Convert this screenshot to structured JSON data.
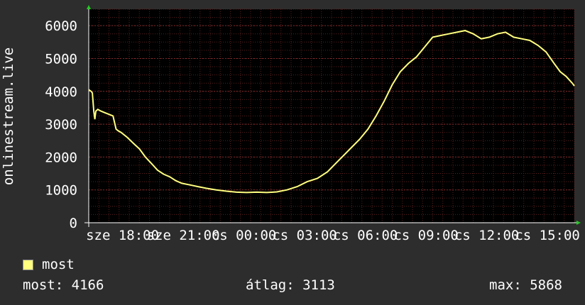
{
  "chart_data": {
    "type": "line",
    "ylabel": "onlinestream.live",
    "ylim": [
      0,
      6500
    ],
    "yticks": [
      0,
      1000,
      2000,
      3000,
      4000,
      5000,
      6000
    ],
    "xticks": [
      {
        "x": 1.67,
        "label": "sze 18:00"
      },
      {
        "x": 4.67,
        "label": "sze 21:00"
      },
      {
        "x": 7.67,
        "label": "cs 00:00"
      },
      {
        "x": 10.67,
        "label": "cs 03:00"
      },
      {
        "x": 13.67,
        "label": "cs 06:00"
      },
      {
        "x": 16.67,
        "label": "cs 09:00"
      },
      {
        "x": 19.67,
        "label": "cs 12:00"
      },
      {
        "x": 22.67,
        "label": "cs 15:00"
      }
    ],
    "xlim": [
      0,
      24
    ],
    "grid": true,
    "colors": {
      "background": "#2d2d2d",
      "plot": "#000000",
      "grid": "#5a1e1e",
      "line": "#ffff80",
      "axis": "#ffffff"
    },
    "series": [
      {
        "name": "most",
        "x": [
          0,
          0.12,
          0.18,
          0.25,
          0.3,
          0.35,
          0.45,
          0.6,
          0.8,
          1.0,
          1.2,
          1.35,
          1.45,
          1.6,
          1.9,
          2.2,
          2.5,
          2.8,
          3.1,
          3.4,
          3.7,
          4.0,
          4.3,
          4.6,
          5.0,
          5.4,
          5.8,
          6.3,
          6.8,
          7.3,
          7.8,
          8.3,
          8.8,
          9.3,
          9.8,
          10.3,
          10.8,
          11.3,
          11.8,
          12.2,
          12.6,
          13.0,
          13.4,
          13.8,
          14.2,
          14.6,
          15.0,
          15.4,
          15.8,
          16.2,
          16.6,
          17.0,
          17.4,
          17.8,
          18.2,
          18.6,
          19.0,
          19.4,
          19.8,
          20.2,
          20.6,
          21.0,
          21.4,
          21.8,
          22.2,
          22.6,
          23.0,
          23.3,
          23.6,
          23.9,
          24.0
        ],
        "values": [
          4050,
          4000,
          3950,
          3400,
          3150,
          3400,
          3450,
          3400,
          3350,
          3300,
          3250,
          2850,
          2800,
          2750,
          2600,
          2420,
          2250,
          2000,
          1800,
          1600,
          1480,
          1400,
          1280,
          1200,
          1150,
          1100,
          1050,
          1000,
          960,
          930,
          920,
          930,
          920,
          940,
          1000,
          1100,
          1250,
          1350,
          1550,
          1800,
          2050,
          2300,
          2550,
          2850,
          3250,
          3700,
          4200,
          4600,
          4850,
          5050,
          5350,
          5650,
          5700,
          5750,
          5800,
          5850,
          5750,
          5600,
          5650,
          5750,
          5800,
          5650,
          5600,
          5550,
          5400,
          5200,
          4850,
          4600,
          4450,
          4250,
          4166
        ]
      }
    ]
  },
  "legend": {
    "series_name": "most",
    "swatch_color": "#ffff80"
  },
  "stats": {
    "now": "most: 4166",
    "avg": "átlag: 3113",
    "max": "max: 5868"
  }
}
